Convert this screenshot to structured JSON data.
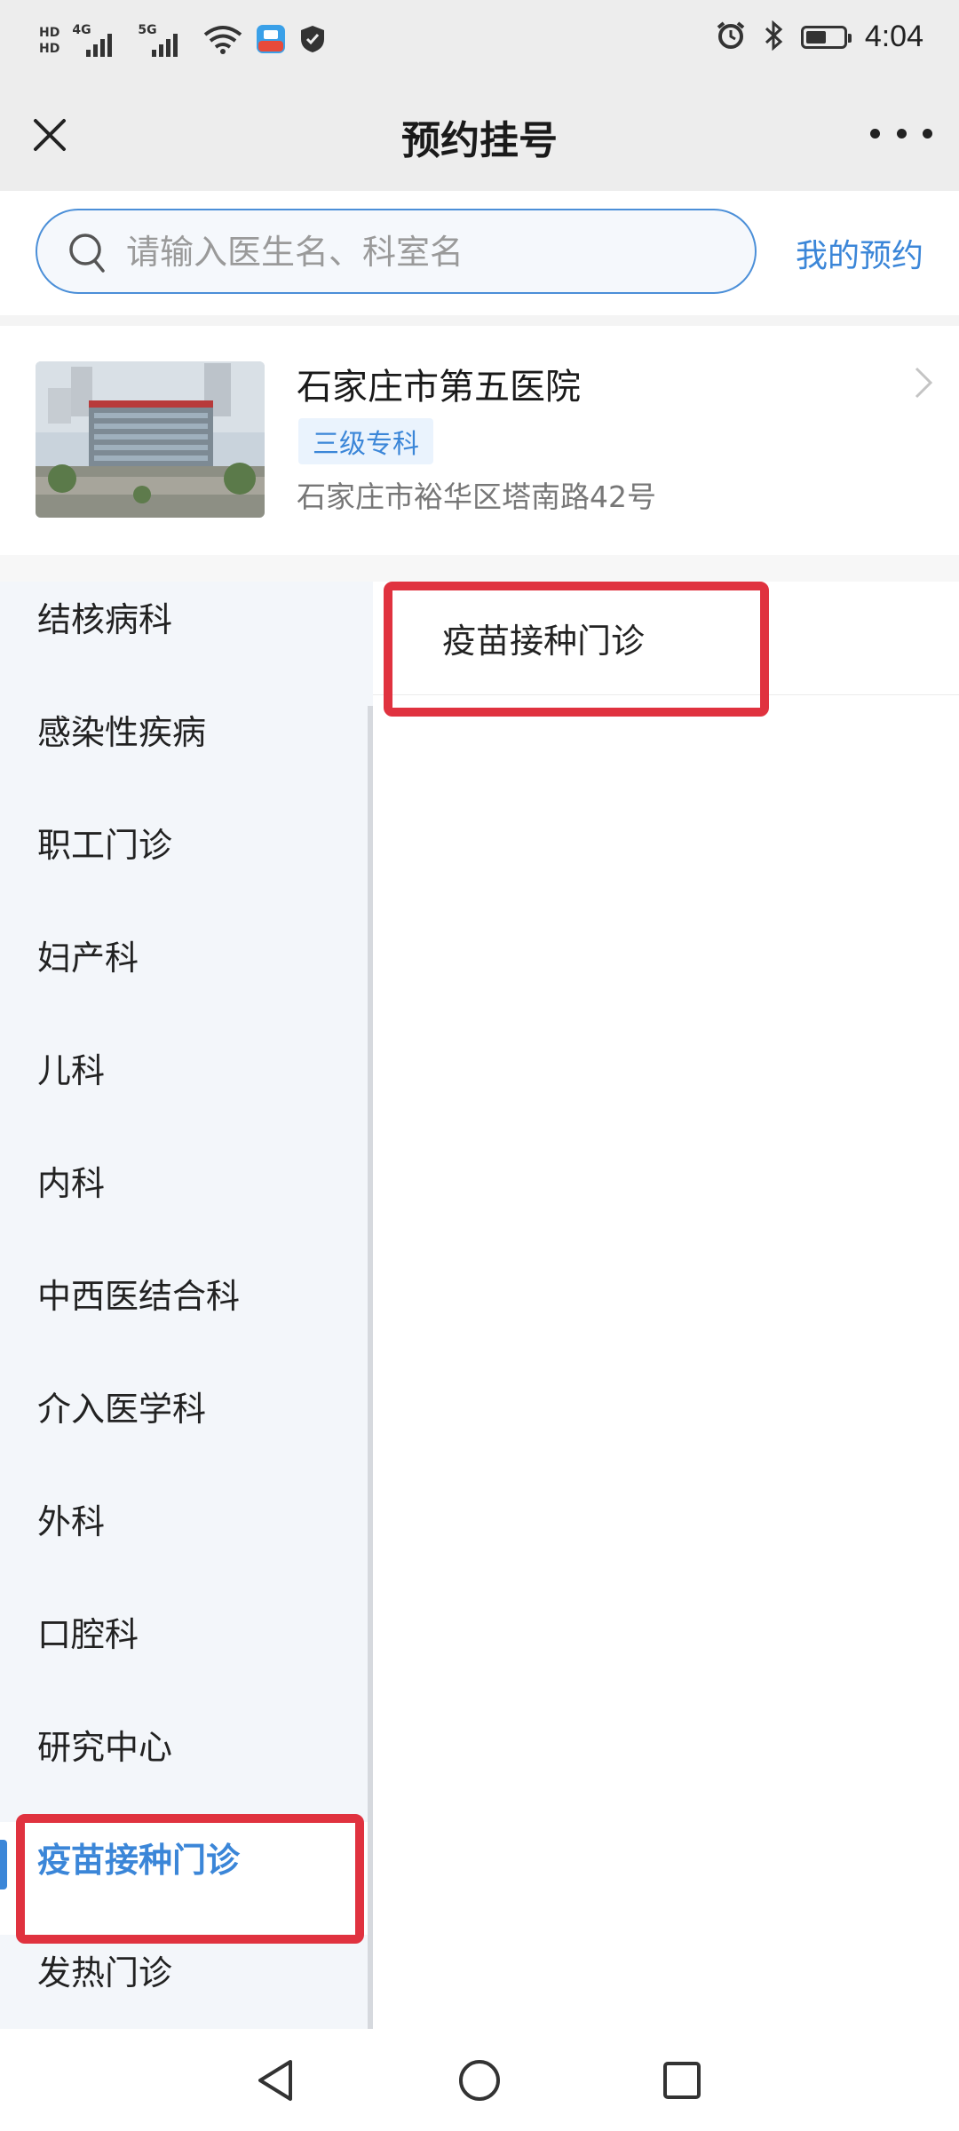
{
  "status_bar": {
    "hd_label": "HD",
    "net1": "4G",
    "net2": "5G",
    "time": "4:04",
    "icons": [
      "signal-icon",
      "wifi-icon",
      "app-icon",
      "shield-icon",
      "alarm-icon",
      "bluetooth-icon",
      "battery-icon"
    ],
    "battery_level": 0.55
  },
  "header": {
    "title": "预约挂号"
  },
  "search": {
    "placeholder": "请输入医生名、科室名",
    "value": "",
    "my_appointments": "我的预约"
  },
  "hospital": {
    "name": "石家庄市第五医院",
    "badge": "三级专科",
    "address": "石家庄市裕华区塔南路42号"
  },
  "departments": [
    {
      "label": "结核病科"
    },
    {
      "label": "感染性疾病"
    },
    {
      "label": "职工门诊"
    },
    {
      "label": "妇产科"
    },
    {
      "label": "儿科"
    },
    {
      "label": "内科"
    },
    {
      "label": "中西医结合科"
    },
    {
      "label": "介入医学科"
    },
    {
      "label": "外科"
    },
    {
      "label": "口腔科"
    },
    {
      "label": "研究中心"
    },
    {
      "label": "疫苗接种门诊"
    },
    {
      "label": "发热门诊"
    }
  ],
  "selected_department": "疫苗接种门诊",
  "sub_departments": [
    {
      "label": "疫苗接种门诊"
    }
  ],
  "colors": {
    "accent": "#3b86d8",
    "highlight_box": "#e0323f",
    "header_bg": "#ededed",
    "sidebar_bg": "#f3f6fa"
  }
}
